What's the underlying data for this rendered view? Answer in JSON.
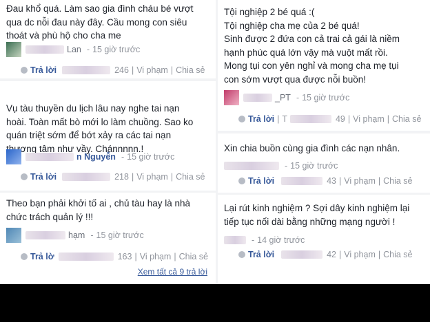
{
  "left": [
    {
      "text": "Đau khổ quá. Làm sao gia đình cháu bé vượt\nqua dc nỗi đau này đây. Cầu mong con siêu\nthoát và phù hộ cho cha me",
      "author_visible": "Lan",
      "time": "15 giờ trước",
      "reply": "Trả lời",
      "likes": "246",
      "report": "Vi phạm",
      "share": "Chia sẻ"
    },
    {
      "text": "Vụ tàu thuyền du lịch lâu nay nghe tai nạn\nhoài. Toàn mất bò mới lo làm chuồng. Sao ko\nquán triệt sớm để bớt xảy ra các tai nạn\nthương tâm như vầy. Chánnnnn.!",
      "author_visible": "n Nguyễn",
      "time": "15 giờ trước",
      "reply": "Trả lời",
      "likes": "218",
      "report": "Vi phạm",
      "share": "Chia sẻ"
    },
    {
      "text": "Theo bạn phải khởi tố ai , chủ tàu hay là nhà\nchức trách quản lý !!!",
      "author_visible": "hạm",
      "time": "15 giờ trước",
      "reply": "Trả lờ",
      "likes": "163",
      "report": "Vi phạm",
      "share": "Chia sẻ",
      "see_all": "Xem tất cả 9 trả lời"
    }
  ],
  "right": [
    {
      "text": "Tội nghiệp 2 bé quá :(\nTội nghiệp cha mẹ của 2 bé quá!\nSinh được 2 đứa con cả trai cả gái là niềm\nhạnh phúc quá lớn vậy mà vuột mất rồi.\nMong tụi con yên nghỉ và mong cha mẹ tụi\ncon sớm vượt qua được nỗi buồn!",
      "author_visible": "_PT",
      "time": "15 giờ trước",
      "reply": "Trả lời",
      "reply_suffix": "T",
      "likes": "49",
      "report": "Vi phạm",
      "share": "Chia sẻ"
    },
    {
      "text": "Xin chia buồn cùng gia đình các nạn nhân.",
      "author_visible": "",
      "time": "15 giờ trước",
      "reply": "Trả lời",
      "likes": "43",
      "report": "Vi phạm",
      "share": "Chia sẻ"
    },
    {
      "text": "Lại rút kinh nghiệm ? Sợi dây kinh nghiệm lại\ntiếp tục nối dài bằng những mạng người !",
      "author_visible": "",
      "time": "14 giờ trước",
      "reply": "Trả lời",
      "likes": "42",
      "report": "Vi phạm",
      "share": "Chia sẻ"
    }
  ]
}
